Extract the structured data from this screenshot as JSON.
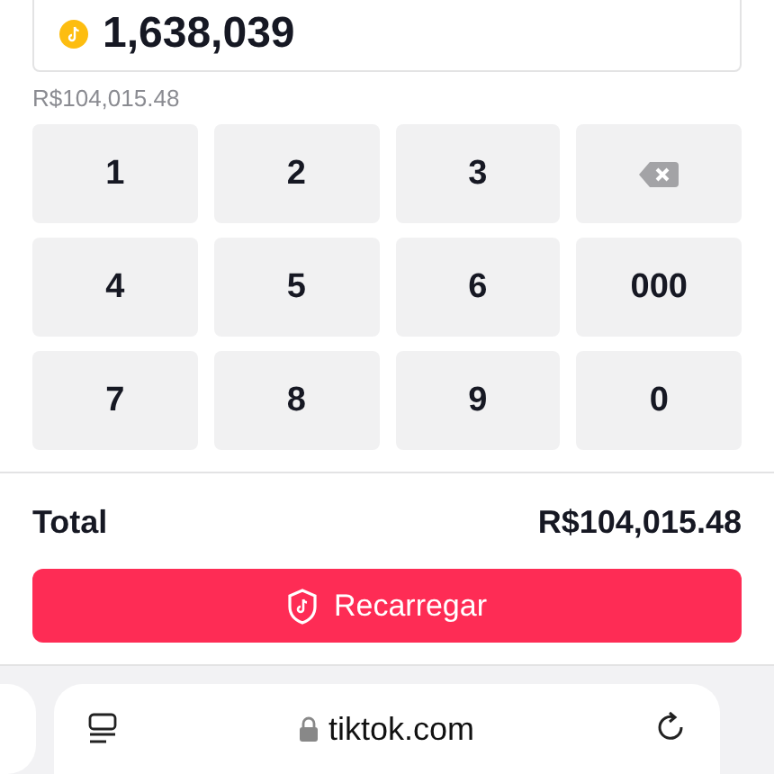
{
  "amount": {
    "value": "1,638,039"
  },
  "equivalent": "R$104,015.48",
  "keypad": [
    {
      "kind": "digit",
      "label": "1"
    },
    {
      "kind": "digit",
      "label": "2"
    },
    {
      "kind": "digit",
      "label": "3"
    },
    {
      "kind": "backspace"
    },
    {
      "kind": "digit",
      "label": "4"
    },
    {
      "kind": "digit",
      "label": "5"
    },
    {
      "kind": "digit",
      "label": "6"
    },
    {
      "kind": "digit",
      "label": "000"
    },
    {
      "kind": "digit",
      "label": "7"
    },
    {
      "kind": "digit",
      "label": "8"
    },
    {
      "kind": "digit",
      "label": "9"
    },
    {
      "kind": "digit",
      "label": "0"
    }
  ],
  "total": {
    "label": "Total",
    "value": "R$104,015.48"
  },
  "recharge_button": "Recarregar",
  "browser_bar": {
    "url": "tiktok.com"
  }
}
